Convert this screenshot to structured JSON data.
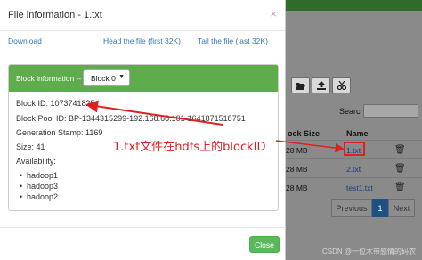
{
  "modal": {
    "title": "File information - 1.txt",
    "close_glyph": "×",
    "links": {
      "download": "Download",
      "head": "Head the file (first 32K)",
      "tail": "Tail the file (last 32K)"
    },
    "block_info_label": "Block information --",
    "block_select_value": "Block 0",
    "block_id": "Block ID: 1073741825",
    "block_pool_id": "Block Pool ID: BP-1344315299-192.168.68.101-1641871518751",
    "generation_stamp": "Generation Stamp: 1169",
    "size": "Size: 41",
    "availability_label": "Availability:",
    "availability": [
      "hadoop1",
      "hadoop3",
      "hadoop2"
    ],
    "close_button": "Close"
  },
  "annotation": {
    "text": "1.txt文件在hdfs上的blockID",
    "color": "#e02020"
  },
  "background": {
    "search_label": "Search:",
    "columns": {
      "block_size": "ock Size",
      "name": "Name"
    },
    "rows": [
      {
        "size": "28 MB",
        "name": "1.txt"
      },
      {
        "size": "28 MB",
        "name": "2.txt"
      },
      {
        "size": "28 MB",
        "name": "test1.txt"
      }
    ],
    "pagination": {
      "previous": "Previous",
      "current": "1",
      "next": "Next"
    },
    "toolbar_icons": [
      "folder-open-icon",
      "upload-icon",
      "cut-icon"
    ]
  },
  "watermark": "CSDN @一位木带感情的码农"
}
